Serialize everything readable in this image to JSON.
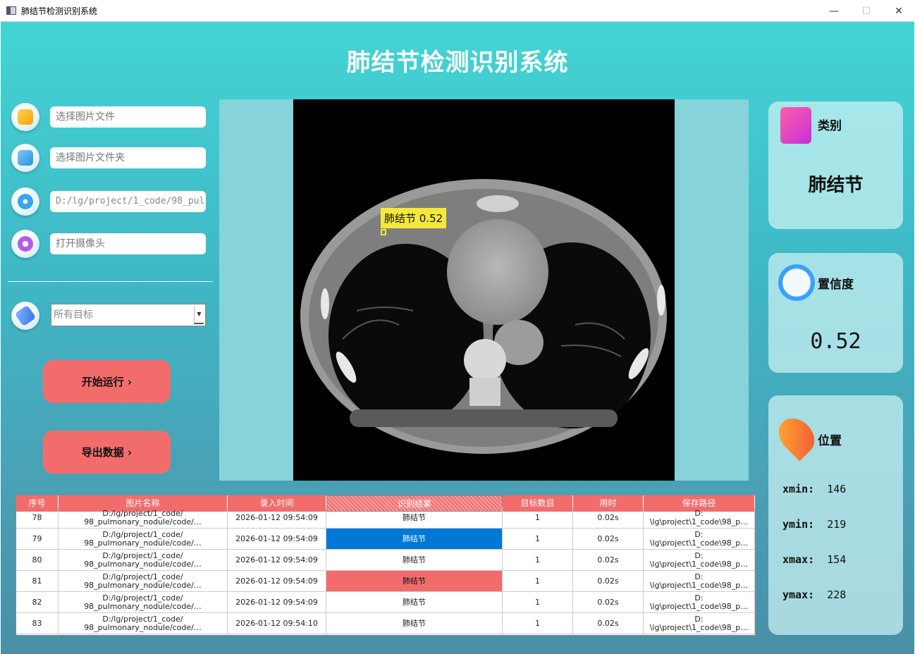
{
  "window": {
    "title": "肺结节检测识别系统",
    "buttons": [
      "—",
      "☐",
      "✕"
    ]
  },
  "page_title": "肺结节检测识别系统",
  "inputs": {
    "image_file": "选择图片文件",
    "image_folder": "选择图片文件夹",
    "video_path": "D:/lg/project/1_code/98_pul",
    "camera": "打开摄像头"
  },
  "target_select": "所有目标",
  "buttons": {
    "run": "开始运行 ›",
    "export": "导出数据 ›"
  },
  "detection": {
    "label": "肺结节 0.52"
  },
  "cards": {
    "category": {
      "title": "类别",
      "value": "肺结节"
    },
    "confidence": {
      "title": "置信度",
      "value": "0.52"
    },
    "position": {
      "title": "位置",
      "xmin_label": "xmin:",
      "xmin": "146",
      "ymin_label": "ymin:",
      "ymin": "219",
      "xmax_label": "xmax:",
      "xmax": "154",
      "ymax_label": "ymax:",
      "ymax": "228"
    }
  },
  "table": {
    "headers": [
      "序号",
      "图片名称",
      "录入时间",
      "识别结果",
      "目标数目",
      "用时",
      "保存路径"
    ],
    "rows": [
      {
        "id": "78",
        "name1": "D:/lg/project/1_code/",
        "name2": "98_pulmonary_nodule/code/…",
        "time": "2026-01-12 09:54:09",
        "result": "肺结节",
        "count": "1",
        "cost": "0.02s",
        "path1": "D:",
        "path2": "\\lg\\project\\1_code\\98_p…"
      },
      {
        "id": "79",
        "name1": "D:/lg/project/1_code/",
        "name2": "98_pulmonary_nodule/code/…",
        "time": "2026-01-12 09:54:09",
        "result": "肺结节",
        "count": "1",
        "cost": "0.02s",
        "path1": "D:",
        "path2": "\\lg\\project\\1_code\\98_p…"
      },
      {
        "id": "80",
        "name1": "D:/lg/project/1_code/",
        "name2": "98_pulmonary_nodule/code/…",
        "time": "2026-01-12 09:54:09",
        "result": "肺结节",
        "count": "1",
        "cost": "0.02s",
        "path1": "D:",
        "path2": "\\lg\\project\\1_code\\98_p…"
      },
      {
        "id": "81",
        "name1": "D:/lg/project/1_code/",
        "name2": "98_pulmonary_nodule/code/…",
        "time": "2026-01-12 09:54:09",
        "result": "肺结节",
        "count": "1",
        "cost": "0.02s",
        "path1": "D:",
        "path2": "\\lg\\project\\1_code\\98_p…"
      },
      {
        "id": "82",
        "name1": "D:/lg/project/1_code/",
        "name2": "98_pulmonary_nodule/code/…",
        "time": "2026-01-12 09:54:09",
        "result": "肺结节",
        "count": "1",
        "cost": "0.02s",
        "path1": "D:",
        "path2": "\\lg\\project\\1_code\\98_p…"
      },
      {
        "id": "83",
        "name1": "D:/lg/project/1_code/",
        "name2": "98_pulmonary_nodule/code/…",
        "time": "2026-01-12 09:54:10",
        "result": "肺结节",
        "count": "1",
        "cost": "0.02s",
        "path1": "D:",
        "path2": "\\lg\\project\\1_code\\98_p…"
      }
    ]
  },
  "colors": {
    "accent_red": "#f36c6c",
    "selection_blue": "#0078d7",
    "label_yellow": "#f4e83a"
  }
}
